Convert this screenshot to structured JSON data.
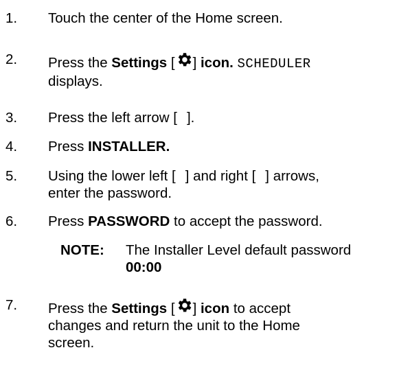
{
  "steps": [
    {
      "num": "1.",
      "text": "Touch the center of the Home screen."
    },
    {
      "num": "2.",
      "pre": "Press the ",
      "bold1": "Settings",
      "open": " [",
      "close": "]",
      "bold2": " icon.",
      "space": " ",
      "mono": "SCHEDULER",
      "line2": "displays.",
      "icon": "gear-icon"
    },
    {
      "num": "3.",
      "pre": "Press the left arrow [",
      "post": "]."
    },
    {
      "num": "4.",
      "pre": "Press ",
      "bold": "INSTALLER."
    },
    {
      "num": "5.",
      "pre": "Using the lower left [",
      "mid": "] and right [",
      "post": "] arrows,",
      "line2": "enter the password."
    },
    {
      "num": "6.",
      "pre": "Press ",
      "bold": "PASSWORD",
      "post": " to accept the password."
    },
    {
      "num": "7.",
      "pre": "Press the ",
      "bold1": "Settings",
      "open": " [",
      "close": "]",
      "bold2": " icon",
      "post": " to accept",
      "line2": "changes and return the unit to the Home",
      "line3": "screen.",
      "icon": "gear-icon"
    }
  ],
  "note": {
    "label": "NOTE:",
    "text": "The Installer Level default password",
    "value": "00:00"
  }
}
